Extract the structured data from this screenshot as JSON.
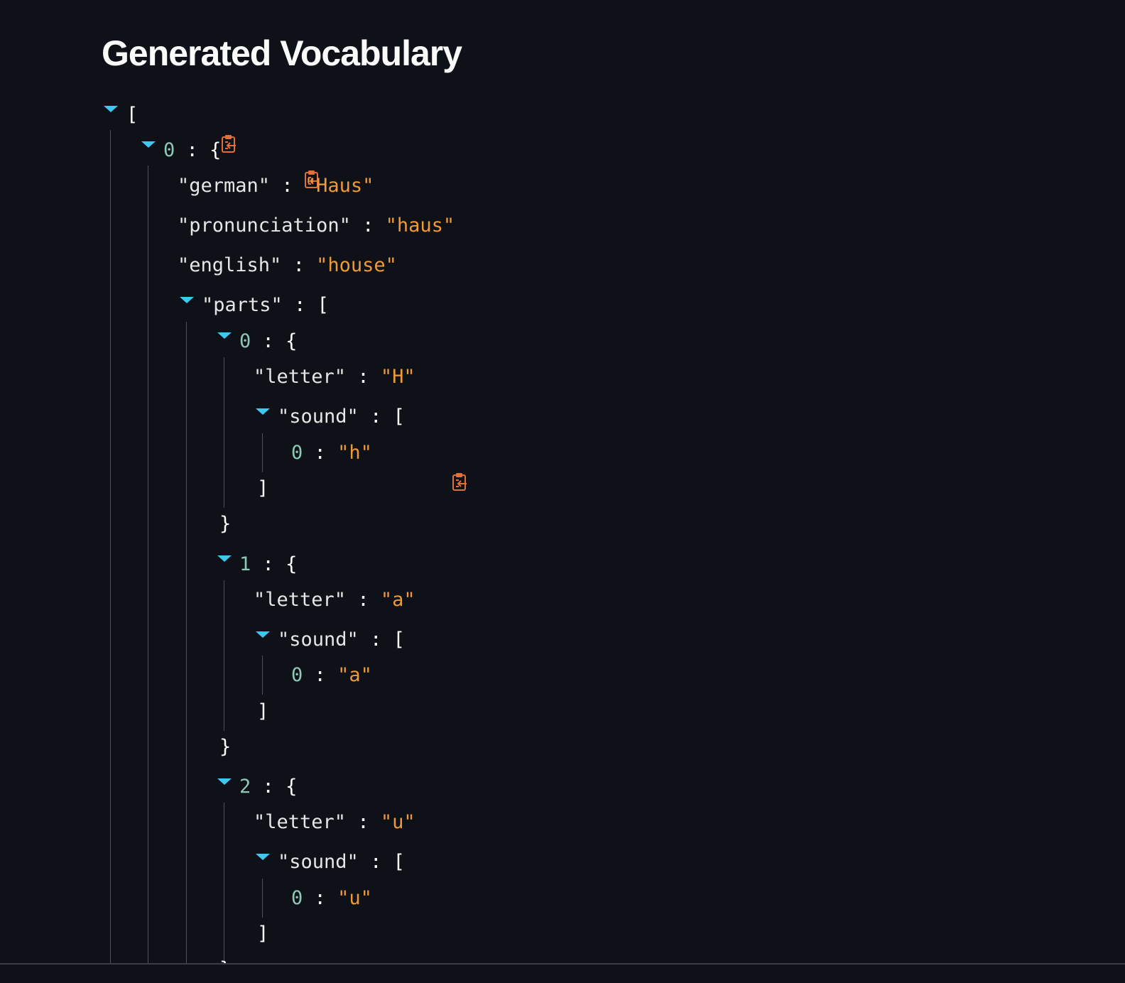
{
  "page": {
    "title": "Generated Vocabulary"
  },
  "json_viewer": {
    "root_open": "[",
    "item0": {
      "index": "0",
      "open": "{",
      "german_key": "\"german\"",
      "german_value": "\"Haus\"",
      "pronunciation_key": "\"pronunciation\"",
      "pronunciation_value": "\"haus\"",
      "english_key": "\"english\"",
      "english_value": "\"house\"",
      "parts_key": "\"parts\"",
      "parts_open": "[",
      "parts": [
        {
          "index": "0",
          "letter_key": "\"letter\"",
          "letter_value": "\"H\"",
          "sound_key": "\"sound\"",
          "sound": [
            {
              "index": "0",
              "value": "\"h\""
            }
          ]
        },
        {
          "index": "1",
          "letter_key": "\"letter\"",
          "letter_value": "\"a\"",
          "sound_key": "\"sound\"",
          "sound": [
            {
              "index": "0",
              "value": "\"a\""
            }
          ]
        },
        {
          "index": "2",
          "letter_key": "\"letter\"",
          "letter_value": "\"u\"",
          "sound_key": "\"sound\"",
          "sound": [
            {
              "index": "0",
              "value": "\"u\""
            }
          ]
        }
      ]
    },
    "colon": ":",
    "obj_open": "{",
    "obj_close": "}",
    "arr_open": "[",
    "arr_close": "]"
  },
  "colors": {
    "background": "#0e1117",
    "string": "#ee9a3a",
    "index": "#8dc8b6",
    "toggle": "#3ec7ef",
    "copy_icon": "#e0703a"
  },
  "icons": {
    "toggle": "caret-down-icon",
    "copy": "clipboard-copy-icon"
  }
}
